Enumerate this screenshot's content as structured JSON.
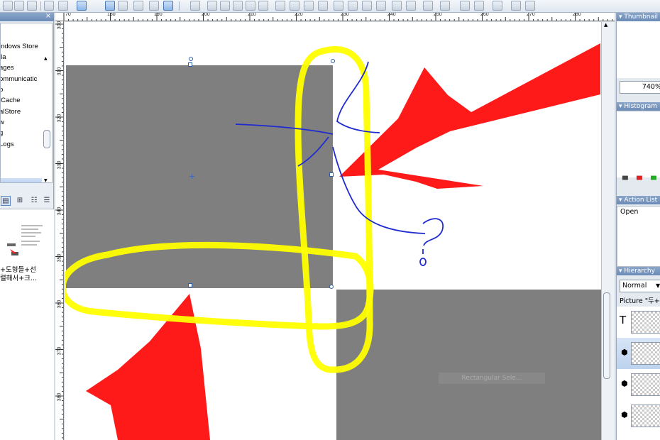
{
  "left_panel": {
    "close_glyph": "×",
    "tree_items": [
      "indows Store",
      "lla",
      "ages",
      "ommunicatic",
      "p",
      "lCache",
      "alStore",
      "w",
      "g",
      "Logs"
    ],
    "view_modes": [
      "▤",
      "⊞",
      "☷",
      "☰"
    ],
    "file_name_line1": "+도형들+선",
    "file_name_line2": "렬해서+크..."
  },
  "ruler": {
    "top_labels": [
      "70",
      "180",
      "190",
      "200",
      "210",
      "220",
      "230",
      "240",
      "250",
      "260",
      "270",
      "280"
    ],
    "left_labels": [
      "300",
      "310",
      "320",
      "330",
      "340",
      "350",
      "360",
      "370",
      "380"
    ]
  },
  "canvas": {
    "rect_label": "Rectangular Sele..."
  },
  "right_panel": {
    "thumbnail_title": "Thumbnail",
    "zoom": "740%",
    "histogram_title": "Histogram",
    "action_list_title": "Action List",
    "action_open": "Open",
    "hierarchy_title": "Hierarchy",
    "blend_mode": "Normal",
    "layer_title": "Picture \"두+",
    "layers": [
      {
        "icon": "text-icon",
        "glyph": "T"
      },
      {
        "icon": "shape-icon",
        "glyph": "⬢"
      },
      {
        "icon": "shape-icon",
        "glyph": "⬢"
      },
      {
        "icon": "shape-icon",
        "glyph": "⬢"
      }
    ]
  },
  "annotations": {
    "question_mark": "?"
  },
  "colors": {
    "canvas_gray": "#7f7f7f",
    "arrow_red": "#ff0000",
    "marker_yellow": "#ffff00",
    "pen_blue": "#1f2bd1",
    "panel_header": "#7a97c0"
  }
}
